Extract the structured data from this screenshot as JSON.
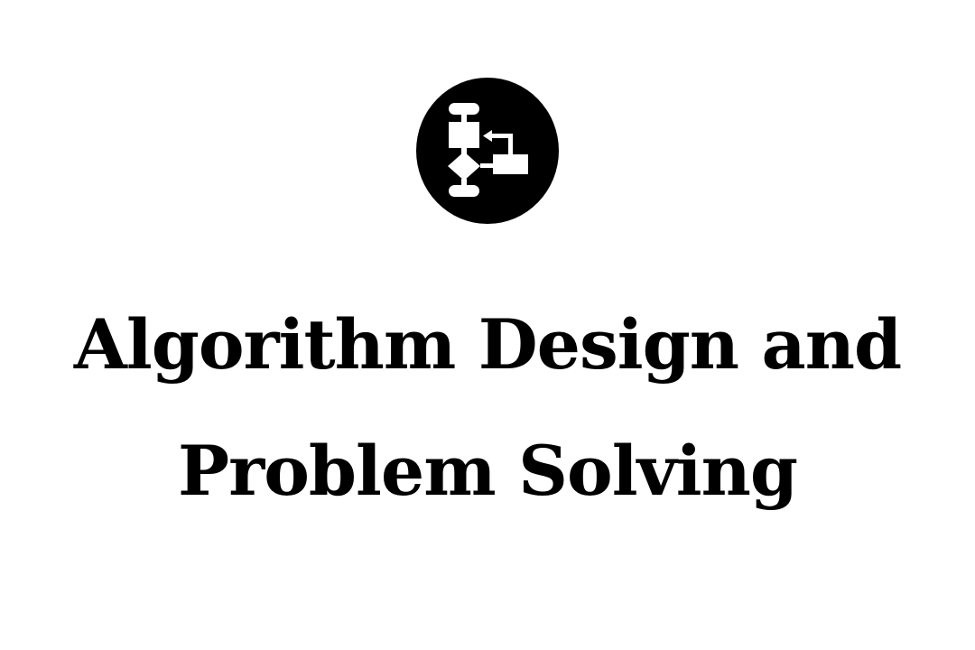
{
  "icon": "flowchart-icon",
  "title": {
    "line1": "Algorithm Design and",
    "line2": "Problem Solving"
  },
  "colors": {
    "background": "#ffffff",
    "foreground": "#000000"
  }
}
